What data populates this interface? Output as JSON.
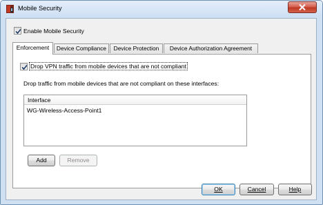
{
  "window": {
    "title": "Mobile Security"
  },
  "enable_checkbox": {
    "label": "Enable Mobile Security",
    "checked": true
  },
  "tabs": [
    {
      "label": "Enforcement",
      "active": true
    },
    {
      "label": "Device Compliance",
      "active": false
    },
    {
      "label": "Device Protection",
      "active": false
    },
    {
      "label": "Device Authorization Agreement",
      "active": false
    }
  ],
  "enforcement": {
    "drop_vpn_label": "Drop VPN traffic from mobile devices that are not compliant",
    "drop_vpn_checked": true,
    "interfaces_caption": "Drop traffic from mobile devices that are not compliant on these interfaces:",
    "table": {
      "columns": [
        "Interface"
      ],
      "rows": [
        [
          "WG-Wireless-Access-Point1"
        ]
      ]
    },
    "add_label": "Add",
    "remove_label": "Remove"
  },
  "footer": {
    "ok_label": "OK",
    "cancel_label": "Cancel",
    "help_label": "Help"
  },
  "colors": {
    "title_bg": "#cddff3",
    "close_red": "#c03a24",
    "dialog_bg": "#f0f0f0"
  }
}
